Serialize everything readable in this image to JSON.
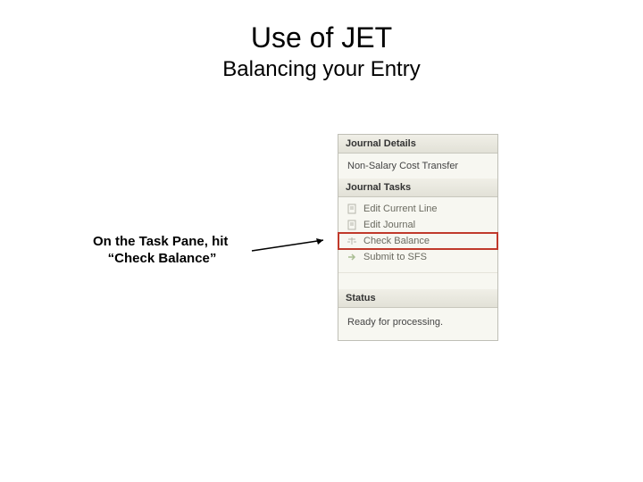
{
  "title": "Use of JET",
  "subtitle": "Balancing your Entry",
  "instruction_line1": "On the Task Pane, hit",
  "instruction_line2": "“Check Balance”",
  "pane": {
    "details_header": "Journal Details",
    "details_value": "Non-Salary Cost Transfer",
    "tasks_header": "Journal Tasks",
    "tasks": [
      {
        "label": "Edit Current Line",
        "icon": "document-icon"
      },
      {
        "label": "Edit Journal",
        "icon": "document-icon"
      },
      {
        "label": "Check Balance",
        "icon": "balance-icon",
        "highlight": true
      },
      {
        "label": "Submit to SFS",
        "icon": "arrow-right-icon"
      }
    ],
    "status_header": "Status",
    "status_value": "Ready for processing."
  }
}
